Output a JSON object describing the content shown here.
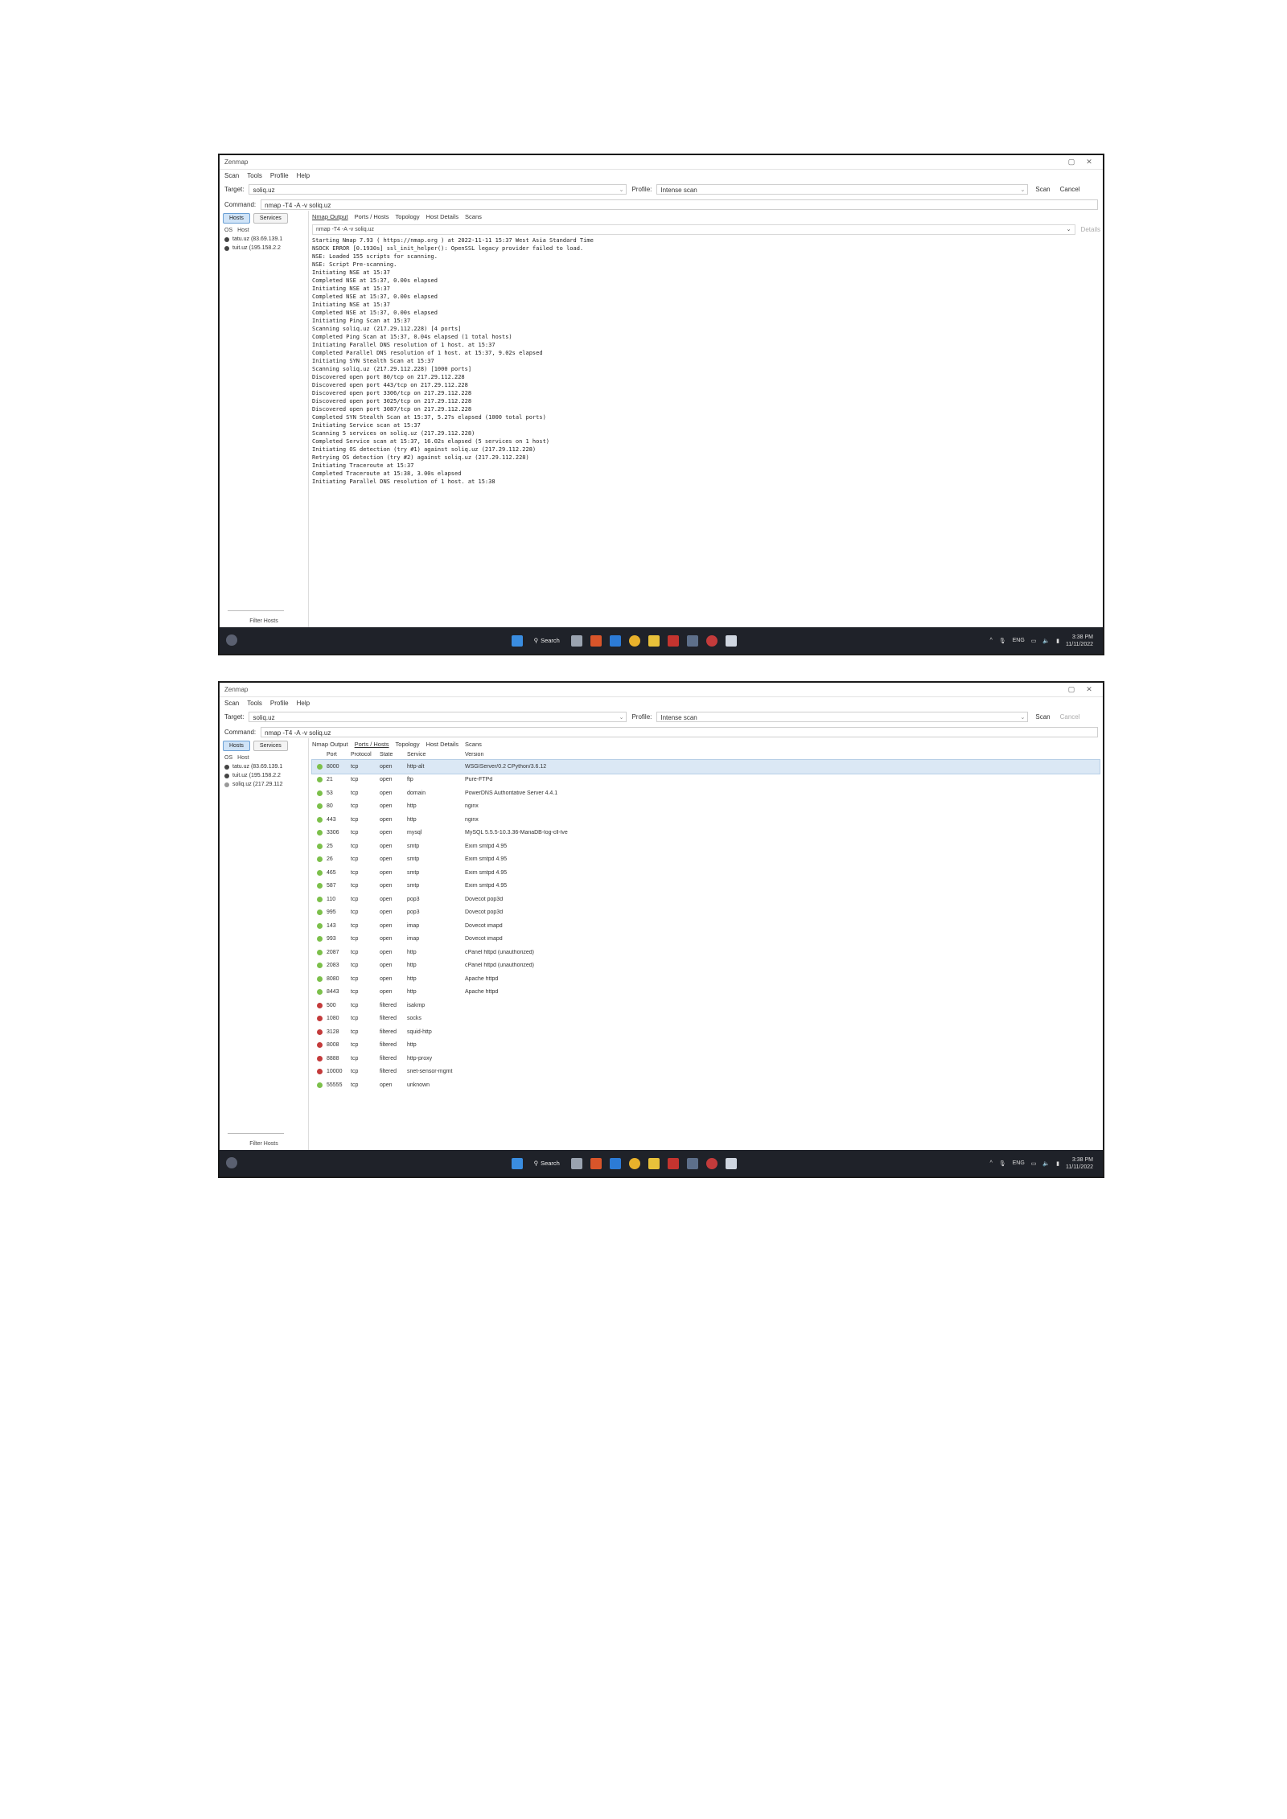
{
  "colors": {
    "open": "#7cc04b",
    "filtered": "#c43b3b",
    "taskbar": "#1f2229",
    "accent": "#6a9fd4"
  },
  "window": {
    "title": "Zenmap",
    "menu": [
      "Scan",
      "Tools",
      "Profile",
      "Help"
    ],
    "target_label": "Target:",
    "profile_label": "Profile:",
    "command_label": "Command:",
    "scan_label": "Scan",
    "cancel_label": "Cancel",
    "left_tabs": [
      "Hosts",
      "Services"
    ],
    "os_label": "OS",
    "host_label": "Host",
    "filter_hosts": "Filter Hosts",
    "tabs": [
      "Nmap Output",
      "Ports / Hosts",
      "Topology",
      "Host Details",
      "Scans"
    ],
    "details_label": "Details"
  },
  "shot1": {
    "target": "soliq.uz",
    "profile": "Intense scan",
    "command": "nmap -T4 -A -v soliq.uz",
    "nmap_cmd": "nmap -T4 -A -v soliq.uz",
    "hosts": [
      "tatu.uz (83.69.139.1",
      "tuit.uz (195.158.2.2"
    ],
    "output": [
      "Starting Nmap 7.93 ( https://nmap.org ) at 2022-11-11 15:37 West Asia Standard Time",
      "NSOCK ERROR [0.1930s] ssl_init_helper(): OpenSSL legacy provider failed to load.",
      "",
      "NSE: Loaded 155 scripts for scanning.",
      "NSE: Script Pre-scanning.",
      "Initiating NSE at 15:37",
      "Completed NSE at 15:37, 0.00s elapsed",
      "Initiating NSE at 15:37",
      "Completed NSE at 15:37, 0.00s elapsed",
      "Initiating NSE at 15:37",
      "Completed NSE at 15:37, 0.00s elapsed",
      "Initiating Ping Scan at 15:37",
      "Scanning soliq.uz (217.29.112.228) [4 ports]",
      "Completed Ping Scan at 15:37, 0.04s elapsed (1 total hosts)",
      "Initiating Parallel DNS resolution of 1 host. at 15:37",
      "Completed Parallel DNS resolution of 1 host. at 15:37, 9.02s elapsed",
      "Initiating SYN Stealth Scan at 15:37",
      "Scanning soliq.uz (217.29.112.228) [1000 ports]",
      "Discovered open port 80/tcp on 217.29.112.228",
      "Discovered open port 443/tcp on 217.29.112.228",
      "Discovered open port 3306/tcp on 217.29.112.228",
      "Discovered open port 3025/tcp on 217.29.112.228",
      "Discovered open port 3087/tcp on 217.29.112.228",
      "Completed SYN Stealth Scan at 15:37, 5.27s elapsed (1000 total ports)",
      "Initiating Service scan at 15:37",
      "Scanning 5 services on soliq.uz (217.29.112.228)",
      "Completed Service scan at 15:37, 16.02s elapsed (5 services on 1 host)",
      "Initiating OS detection (try #1) against soliq.uz (217.29.112.228)",
      "Retrying OS detection (try #2) against soliq.uz (217.29.112.228)",
      "Initiating Traceroute at 15:37",
      "Completed Traceroute at 15:38, 3.00s elapsed",
      "Initiating Parallel DNS resolution of 1 host. at 15:38"
    ],
    "clock_time": "3:38 PM",
    "clock_date": "11/11/2022"
  },
  "shot2": {
    "target": "soliq.uz",
    "profile": "Intense scan",
    "command": "nmap -T4 -A -v soliq.uz",
    "hosts": [
      "tatu.uz (83.69.139.1",
      "tuit.uz (195.158.2.2",
      "soliq.uz (217.29.112"
    ],
    "columns": [
      "Port",
      "Protocol",
      "State",
      "Service",
      "Version"
    ],
    "ports": [
      {
        "port": "8000",
        "proto": "tcp",
        "state": "open",
        "service": "http-alt",
        "version": "WSGIServer/0.2 CPython/3.6.12"
      },
      {
        "port": "21",
        "proto": "tcp",
        "state": "open",
        "service": "ftp",
        "version": "Pure-FTPd"
      },
      {
        "port": "53",
        "proto": "tcp",
        "state": "open",
        "service": "domain",
        "version": "PowerDNS Authoritative Server 4.4.1"
      },
      {
        "port": "80",
        "proto": "tcp",
        "state": "open",
        "service": "http",
        "version": "nginx"
      },
      {
        "port": "443",
        "proto": "tcp",
        "state": "open",
        "service": "http",
        "version": "nginx"
      },
      {
        "port": "3306",
        "proto": "tcp",
        "state": "open",
        "service": "mysql",
        "version": "MySQL 5.5.5-10.3.36-MariaDB-log-cll-lve"
      },
      {
        "port": "25",
        "proto": "tcp",
        "state": "open",
        "service": "smtp",
        "version": "Exim smtpd 4.95"
      },
      {
        "port": "26",
        "proto": "tcp",
        "state": "open",
        "service": "smtp",
        "version": "Exim smtpd 4.95"
      },
      {
        "port": "465",
        "proto": "tcp",
        "state": "open",
        "service": "smtp",
        "version": "Exim smtpd 4.95"
      },
      {
        "port": "587",
        "proto": "tcp",
        "state": "open",
        "service": "smtp",
        "version": "Exim smtpd 4.95"
      },
      {
        "port": "110",
        "proto": "tcp",
        "state": "open",
        "service": "pop3",
        "version": "Dovecot pop3d"
      },
      {
        "port": "995",
        "proto": "tcp",
        "state": "open",
        "service": "pop3",
        "version": "Dovecot pop3d"
      },
      {
        "port": "143",
        "proto": "tcp",
        "state": "open",
        "service": "imap",
        "version": "Dovecot imapd"
      },
      {
        "port": "993",
        "proto": "tcp",
        "state": "open",
        "service": "imap",
        "version": "Dovecot imapd"
      },
      {
        "port": "2087",
        "proto": "tcp",
        "state": "open",
        "service": "http",
        "version": "cPanel httpd (unauthorized)"
      },
      {
        "port": "2083",
        "proto": "tcp",
        "state": "open",
        "service": "http",
        "version": "cPanel httpd (unauthorized)"
      },
      {
        "port": "8080",
        "proto": "tcp",
        "state": "open",
        "service": "http",
        "version": "Apache httpd"
      },
      {
        "port": "8443",
        "proto": "tcp",
        "state": "open",
        "service": "http",
        "version": "Apache httpd"
      },
      {
        "port": "500",
        "proto": "tcp",
        "state": "filtered",
        "service": "isakmp",
        "version": ""
      },
      {
        "port": "1080",
        "proto": "tcp",
        "state": "filtered",
        "service": "socks",
        "version": ""
      },
      {
        "port": "3128",
        "proto": "tcp",
        "state": "filtered",
        "service": "squid-http",
        "version": ""
      },
      {
        "port": "8008",
        "proto": "tcp",
        "state": "filtered",
        "service": "http",
        "version": ""
      },
      {
        "port": "8888",
        "proto": "tcp",
        "state": "filtered",
        "service": "http-proxy",
        "version": ""
      },
      {
        "port": "10000",
        "proto": "tcp",
        "state": "filtered",
        "service": "snet-sensor-mgmt",
        "version": ""
      },
      {
        "port": "55555",
        "proto": "tcp",
        "state": "open",
        "service": "unknown",
        "version": ""
      }
    ],
    "clock_time": "3:38 PM",
    "clock_date": "11/11/2022"
  },
  "taskbar": {
    "search": "Search",
    "lang": "ENG"
  }
}
